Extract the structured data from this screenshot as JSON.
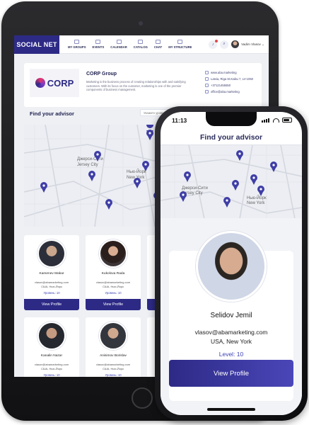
{
  "colors": {
    "brand": "#2d2a86",
    "pin": "#3f3ea6",
    "level": "#3b3fb3",
    "photo_bg": "#cfd6e6"
  },
  "tablet": {
    "brand": "SOCIAL NET",
    "nav": [
      {
        "label": "MY GROUPS",
        "icon": "groups-icon"
      },
      {
        "label": "EVENTS",
        "icon": "events-icon"
      },
      {
        "label": "CALENDAR",
        "icon": "calendar-icon"
      },
      {
        "label": "CATALOG",
        "icon": "catalog-icon"
      },
      {
        "label": "CHAT",
        "icon": "chat-icon"
      },
      {
        "label": "MY STRUCTURE",
        "icon": "structure-icon"
      }
    ],
    "notification_icon": "bell-icon",
    "search_icon": "search-icon",
    "user_name": "Vadim Vlasov",
    "company": {
      "logo_text": "CORP",
      "title": "CORP Group",
      "description": "Marketing is the business process of creating relationships with and satisfying customers. With its focus on the customer, marketing is one of the premier components of business management.",
      "contacts": [
        {
          "icon": "link-icon",
          "text": "www.aba.marketing"
        },
        {
          "icon": "location-icon",
          "text": "Latvia, Riga St.Kaiku 7, LV-1050"
        },
        {
          "icon": "phone-icon",
          "text": "+37121455550"
        },
        {
          "icon": "mail-icon",
          "text": "office@aba.marketing"
        }
      ]
    },
    "find_title": "Find your advisor",
    "filter_placeholder": "Укажите уровень",
    "map_labels": [
      "Джерси-Сити",
      "Jersey City",
      "Нью-Йорк",
      "New York"
    ],
    "advisors": [
      {
        "name": "Kamenev Makar",
        "email": "vlasov@abamarketing.com",
        "city": "США, Нью-Йорк",
        "level": "Уровень: 10",
        "button": "View Profile"
      },
      {
        "name": "Kukolova Rada",
        "email": "vlasov@abamarketing.com",
        "city": "США, Нью-Йорк",
        "level": "Уровень: 10",
        "button": "View Profile"
      },
      {
        "name": "Kanalin Nazar",
        "email": "vlasov@abamarketing.com",
        "city": "США, Нью-Йорк",
        "level": "Уровень: 10",
        "button": "View Profile"
      },
      {
        "name": "Anisimov Borislav",
        "email": "vlasov@abamarketing.com",
        "city": "США, Нью-Йорк",
        "level": "Уровень: 10",
        "button": "View Profile"
      }
    ]
  },
  "phone": {
    "time": "11:13",
    "title": "Find your advisor",
    "map_labels": [
      "Джерси-Сити",
      "Jersey City",
      "Нью-Йорк",
      "New York"
    ],
    "advisor": {
      "name": "Selidov Jemil",
      "email": "vlasov@abamarketing.com",
      "city": "USA, New York",
      "level": "Level: 10",
      "button": "View Profile"
    }
  }
}
